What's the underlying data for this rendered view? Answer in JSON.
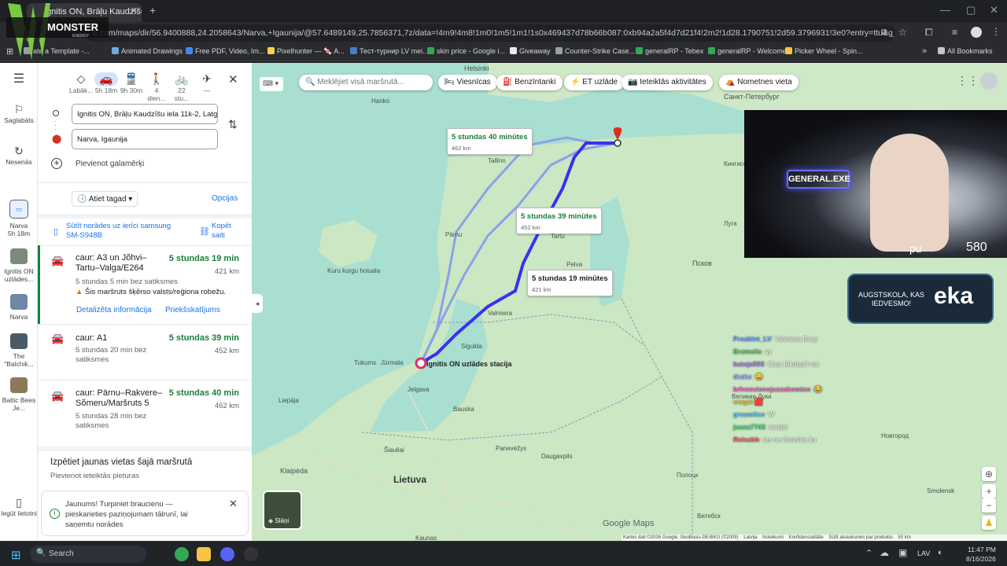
{
  "browser": {
    "tab_title": "Ignitis ON, Brāļu Kaudzīšu iela",
    "url": "e.com/maps/dir/56.9400888,24.2058643/Narva,+Igaunija/@57.6489149,25.7856371,7z/data=!4m9!4m8!1m0!1m5!1m1!1s0x469437d78b66b087:0xb94a2a5f4d7d21f4!2m2!1d28.1790751!2d59.3796931!3e0?entry=ttu&g_ep=EgoyMDI2MD...",
    "bookmarks": [
      "ate a Template -...",
      "Animated Drawings",
      "Free PDF, Video, Im...",
      "Pixelhunter — 🍬 A...",
      "Тест-турнир LV mei...",
      "skin price - Google i...",
      "Giveaway",
      "Counter-Strike Case...",
      "generalRP - Tebex",
      "generalRP - Welcome",
      "Picker Wheel - Spin..."
    ],
    "bookmark_colors": [
      "#9aa0a6",
      "#6fa8dc",
      "#4285f4",
      "#f6d34a",
      "#4d7ac7",
      "#34a853",
      "#e8eaed",
      "#9aa0a6",
      "#34a853",
      "#34a853",
      "#f4c542"
    ],
    "all_bookmarks": "All Bookmarks"
  },
  "overlay": {
    "monster_logo": "MONSTER",
    "monster_sub": "ENERGY",
    "cam_sign": "GENERAL.EXE",
    "cam_text": "pu",
    "cam_count": "580",
    "banner_small": "AUGSTSKOLA, KAS IEDVESMO!",
    "banner_big": "eka",
    "chat": [
      {
        "name": "Preaklnt_LV",
        "text": ": Valmiera Easy",
        "color": "#7aa7ff"
      },
      {
        "name": "Bramelis",
        "text": ": vy",
        "color": "#6fd36f"
      },
      {
        "name": "kutoja593",
        "text": ": Caur jēkabpili vai",
        "color": "#b77cff"
      },
      {
        "name": "drako",
        "text": ": 😀",
        "color": "#9fb3ff"
      },
      {
        "name": "brīvesvienojuszakemine",
        "text": ": 😂",
        "color": "#ff66cc"
      },
      {
        "name": "eragal",
        "text": " 🟥",
        "color": "#ffcc33"
      },
      {
        "name": "gruuwiise",
        "text": ": W",
        "color": "#66ccff"
      },
      {
        "name": "juuza7743",
        "text": ": sesija!",
        "color": "#55dd88"
      },
      {
        "name": "Reinzbb",
        "text": ": tas ne ārmaina ku",
        "color": "#ff6666"
      }
    ]
  },
  "rail": {
    "items": [
      {
        "label": "Saglabāts",
        "icon": "bookmark-icon"
      },
      {
        "label": "Nesenās",
        "icon": "history-icon"
      },
      {
        "label": "Narva",
        "sub": "5h 18m",
        "icon": "car-icon"
      },
      {
        "label": "Ignitis ON uzlādes...",
        "thumb": "#7a8b7a"
      },
      {
        "label": "Narva",
        "thumb": "#6e88a8"
      },
      {
        "label": "The \"Balchik...",
        "thumb": "#4a5a66"
      },
      {
        "label": "Baltic Bees Je...",
        "thumb": "#8a7a5a"
      },
      {
        "label": "Iegūt lietotni",
        "icon": "phone-icon"
      }
    ]
  },
  "panel": {
    "modes": [
      {
        "label": "Labāk...",
        "icon": "◇"
      },
      {
        "label": "5h 18m",
        "icon": "🚗",
        "selected": true
      },
      {
        "label": "9h 30m",
        "icon": "🚆"
      },
      {
        "label": "4 dien...",
        "icon": "🚶"
      },
      {
        "label": "22 stu...",
        "icon": "🚲"
      },
      {
        "label": "—",
        "icon": "✈"
      }
    ],
    "origin": "Ignitis ON, Brāļu Kaudzīšu iela 11k-2, Latg",
    "destination": "Narva, Igaunija",
    "add_destination": "Pievienot galamērķi",
    "depart": "Atiet tagad",
    "options": "Opcijas",
    "send_line1": "Sūtīt norādes uz ierīci samsung",
    "send_line2": "SM-S948B",
    "copy_link1": "Kopēt",
    "copy_link2": "saiti",
    "routes": [
      {
        "title1": "caur: A3 un Jõhvi–",
        "title2": "Tartu–Valga/E264",
        "time": "5 stundas 19 min",
        "km": "421 km",
        "sub1": "5 stundas 5 min bez satiksmes",
        "warning": "Šis maršruts šķērso valsts/reģiona robežu.",
        "details": "Detalizēta informācija",
        "preview": "Priekšskatījums"
      },
      {
        "title1": "caur: A1",
        "title2": "",
        "time": "5 stundas 39 min",
        "km": "452 km",
        "sub1": "5 stundas 20 min bez",
        "sub2": "satiksmes"
      },
      {
        "title1": "caur: Pärnu–Rakvere–",
        "title2": "Sõmeru/Maršruts 5",
        "time": "5 stundas 40 min",
        "km": "462 km",
        "sub1": "5 stundas 28 min bez",
        "sub2": "satiksmes"
      }
    ],
    "explore_title": "Izpētiet jaunas vietas šajā maršrutā",
    "explore_sub": "Pievienot ieteiktās pieturas",
    "notice_line1": "Jaunums! Turpiniet braucienu —",
    "notice_line2": "pieskarieties paziņojumam tālrunī, lai",
    "notice_line3": "saņemtu norādes"
  },
  "map": {
    "search_placeholder": "Meklējiet visā maršrutā...",
    "chips": [
      "Viesnīcas",
      "Benzīntanki",
      "ET uzlāde",
      "Ieteiktās aktivitātes",
      "Nometnes vieta"
    ],
    "route_labels": [
      {
        "time": "5 stundas 40 minūtes",
        "km": "462 km"
      },
      {
        "time": "5 stundas 39 minūtes",
        "km": "452 km"
      },
      {
        "time": "5 stundas 19 minūtes",
        "km": "421 km"
      }
    ],
    "origin_label": "Ignitis ON uzlādes stacija",
    "places": [
      "Helsinki",
      "Hanko",
      "Санкт-Петербург",
      "Tallinn",
      "Pärnu",
      "Tartu",
      "Pelva",
      "Kuru kurgu hoiuala",
      "Valmiera",
      "Sigulda",
      "Jūrmala",
      "Tukums",
      "Jelgava",
      "Liepāja",
      "Bauska",
      "Šiauliai",
      "Daugavpils",
      "Klaipėda",
      "Lietuva",
      "Panevėžys",
      "Kaunas",
      "Smolensk",
      "Псков",
      "Великие Луки",
      "Полоцк",
      "Витебск",
      "Кингисепп",
      "Луга",
      "Новгород"
    ],
    "layers": "Slāņi",
    "google": "Google Maps",
    "footer": [
      "Kartes dati ©2026 Google, GeoBasis-DE/BKG (©2009)",
      "Latvija",
      "Noteikumi",
      "Konfidencialitāte",
      "Sūtīt atsauksmes par produktu",
      "50 km"
    ]
  },
  "taskbar": {
    "search": "Search",
    "lang": "LAV",
    "time": "11:47 PM",
    "date": "8/16/2026"
  }
}
